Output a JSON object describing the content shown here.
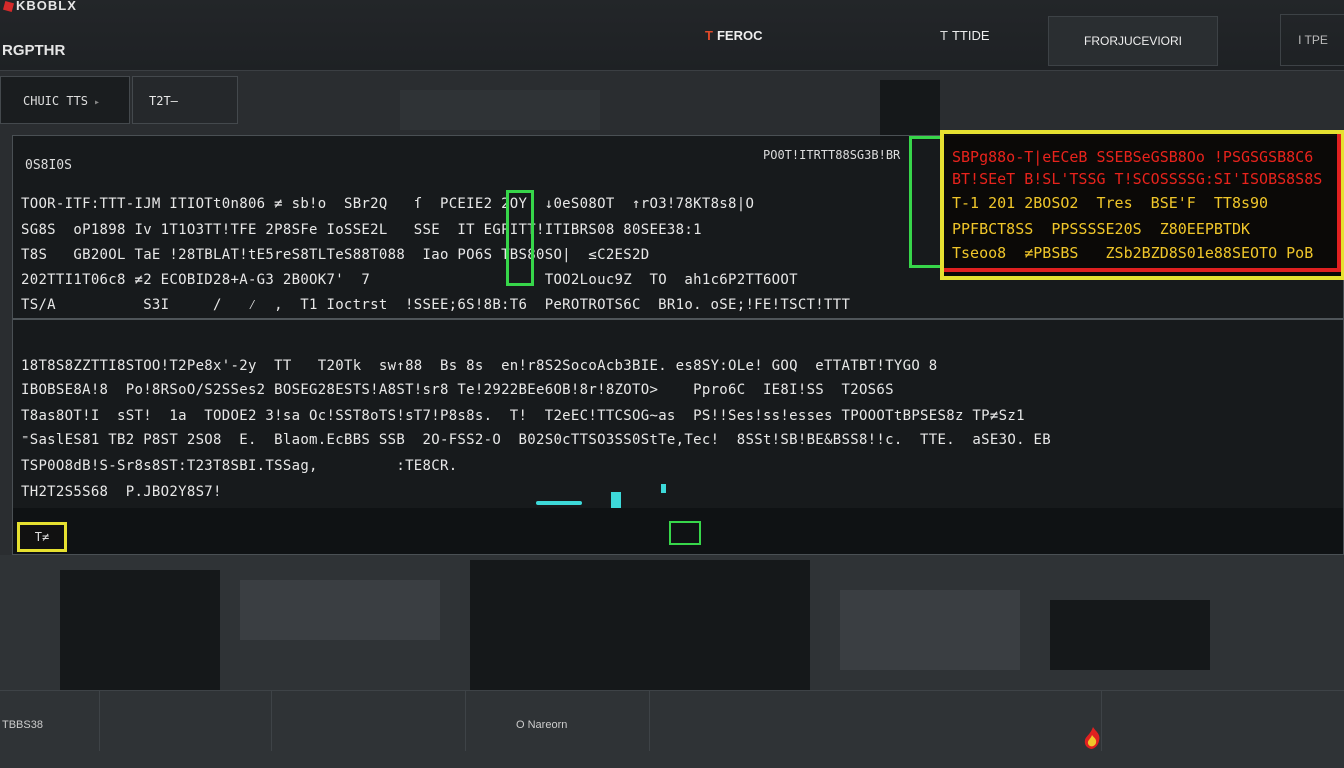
{
  "topbar": {
    "logo_text": "KBOBLX",
    "app_title": "RGPTHR",
    "tabs": [
      {
        "label": "FEROC",
        "mark": "T"
      },
      {
        "label": "TTIDE",
        "mark": "T"
      },
      {
        "label": "FRORJUCEVIORI"
      },
      {
        "label": "I TPE"
      }
    ]
  },
  "subbar": {
    "button_label": "CHUIC TTS",
    "field_value": "T2T—"
  },
  "panel": {
    "title": "0S8I0S",
    "header_right": "PO0T!ITRTT88SG3B!BR",
    "rows": [
      "TOOR-ITF:TTT-IJM ITIOTt0n806 ≠ sb!o  SBr2Q   ſ  PCEIE2 2OY  ↓0eS08OT  ↑rO3!78KT8s8|O",
      "SG8S  oP1898 Iv 1T1O3TT!TFE 2P8SFe IoSSE2L   SSE  IT EGPITT!ITIBRS08 80SEE38:1",
      "T8S   GB20OL TaE !28TBLAT!tE5reS8TLTeS88T088  Iao PO6S TBS80SO|  ≤C2ES2D",
      "202TTI1T06c8 ≠2 ECOBID28+A-G3 2B0OK7'  7                    TOO2Louc9Z  TO  ah1c6P2TT6OOT",
      "TS/A          S3I     /   ⁄  ,  T1 Ioctrst  !SSEE;6S!8B:T6  PeROTROTS6C  BR1o. oSE;!FE!TSCT!TTT"
    ],
    "rows2": [
      "18T8S8ZZTTI8STOO!T2Pe8x'-2y  TT   T20Tk  sw↑88  Bs 8s  en!r8S2SocoAcb3BIE. es8SY:OLe! GOQ  eTTATBT!TYGO 8",
      "IBOBSE8A!8  Po!8RSoO/S2SSes2 BOSEG28ESTS!A8ST!sr8 Te!2922BEe6OB!8r!8ZOTO>    Ppro6C  IE8I!SS  T2OS6S",
      "T8as8OT!I  sST!  1a  TODOE2 3!sa Oc!SST8oTS!sT7!P8s8s.  T!  T2eEC!TTCSOG~as  PS!!Ses!ss!esses TPOOOTtBPSES8z TP≠Sz1",
      "⁼SaslES81 TB2 P8ST 2SO8  E.  Blaom.EcBBS SSB  2O-FSS2-O  B02S0cTTSO3SS0StTe,Tec!  8SSt!SB!BE&BSS8!!c.  TTE.  aSE3O. EB",
      "TSP0O8dB!S-Sr8s8ST:T23T8SBI.TSSag,         :TE8CR.",
      "TH2T2S5S68  P.JBO2Y8S7!"
    ],
    "highlight": [
      {
        "text": "SBPg88o-T|eECeB SSEBSeGSB8Oo !PSGSGSB8C6",
        "tone": "r"
      },
      {
        "text": "BT!SEeT B!SL'TSSG T!SCOSSSSG:SI'ISOBS8S8S",
        "tone": "r"
      },
      {
        "text": "T-1 201 2BOSO2  Tres  BSE'F  TT8s90",
        "tone": "y"
      },
      {
        "text": "PPFBCT8SS  PPSSSSE20S  Z80EEPBTDK",
        "tone": "y"
      },
      {
        "text": "Tseoo8  ≠PBSBS   ZSb2BZD8S01e88SEOTO PoB",
        "tone": "y"
      }
    ],
    "yellow_button_label": "T≠"
  },
  "hotbar": {
    "left_label": "TBBS38",
    "mid_label": "O Nareorn"
  },
  "colors": {
    "accent_green": "#37d64a",
    "accent_yellow": "#e6e030",
    "accent_red": "#e02020",
    "accent_cyan": "#3dd9d9"
  }
}
